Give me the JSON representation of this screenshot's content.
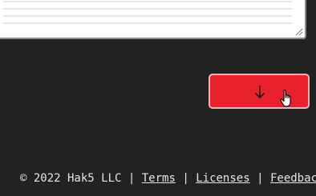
{
  "textarea": {
    "value": ""
  },
  "download_button": {
    "icon": "arrow-down-icon"
  },
  "cursor": {
    "icon": "hand-pointer-icon"
  },
  "footer": {
    "copyright": "© 2022 Hak5 LLC",
    "separator": "|",
    "links": {
      "terms": "Terms",
      "licenses": "Licenses",
      "feedback": "Feedback"
    }
  },
  "colors": {
    "background": "#222222",
    "button": "#e8212c",
    "button_border": "#f6b1b5",
    "text": "#e6e6e6"
  }
}
